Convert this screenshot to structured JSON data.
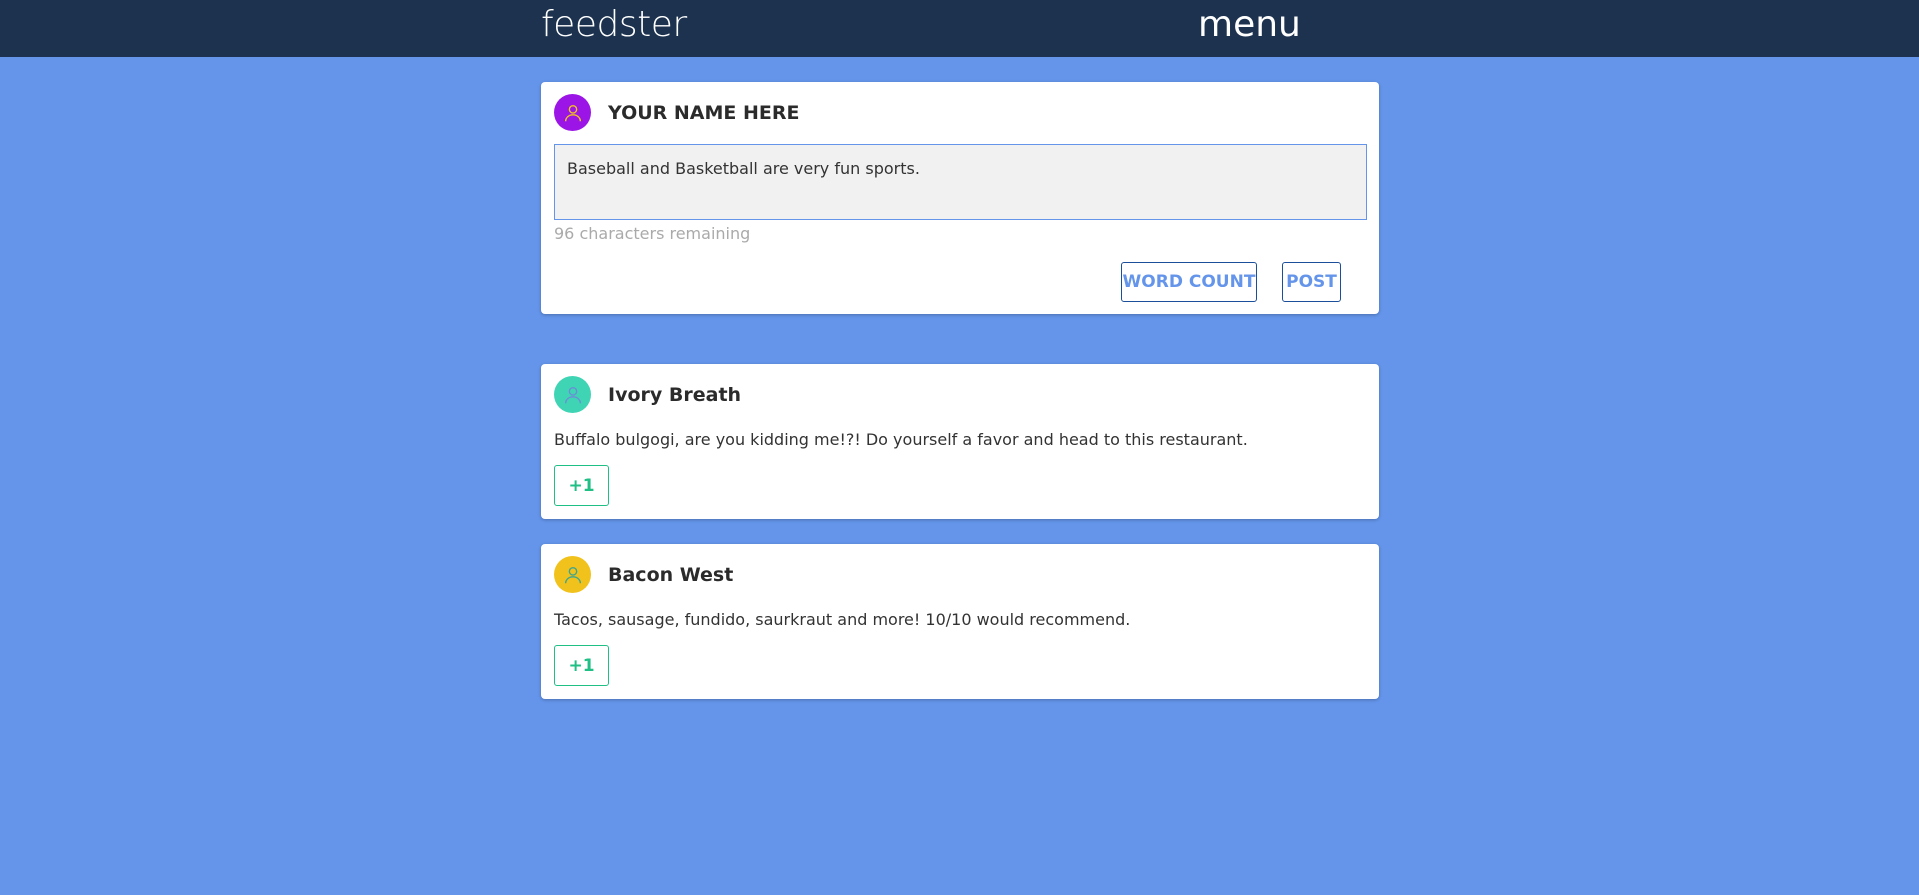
{
  "navbar": {
    "brand": "feedster",
    "menu_label": "menu"
  },
  "composer": {
    "name": "YOUR NAME HERE",
    "avatar_color": "#9b16e6",
    "text_value": "Baseball and Basketball are very fun sports.",
    "remaining": "96 characters remaining",
    "word_count_label": "WORD COUNT",
    "post_label": "POST"
  },
  "posts": [
    {
      "author": "Ivory Breath",
      "avatar_color": "#3fd4b4",
      "body": "Buffalo bulgogi, are you kidding me!?! Do yourself a favor and head to this restaurant.",
      "plus_label": "+1"
    },
    {
      "author": "Bacon West",
      "avatar_color": "#f1c21b",
      "body": "Tacos, sausage, fundido, saurkraut and more! 10/10 would recommend.",
      "plus_label": "+1"
    }
  ],
  "colors": {
    "page_bg": "#6495ea",
    "navbar_bg": "#1c324f",
    "accent": "#6495ea",
    "plus_green": "#1fbf86"
  }
}
